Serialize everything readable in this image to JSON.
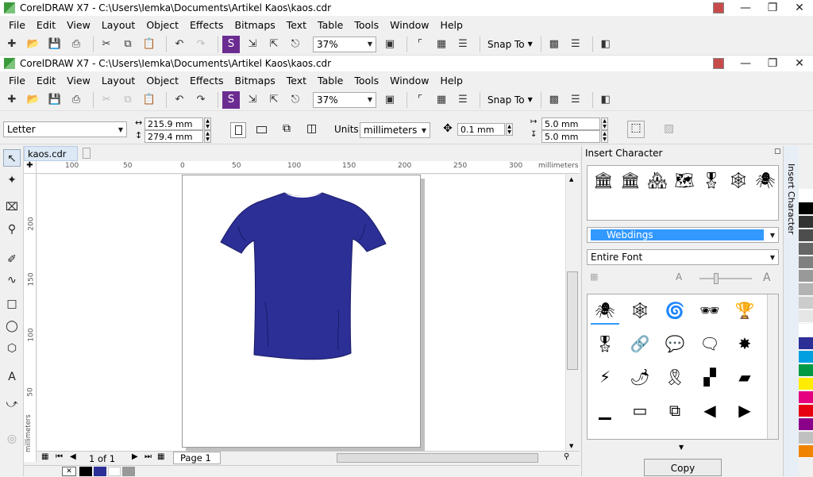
{
  "window1": {
    "title": "CorelDRAW X7 - C:\\Users\\Iemka\\Documents\\Artikel Kaos\\kaos.cdr"
  },
  "window2": {
    "title": "CorelDRAW X7 - C:\\Users\\Iemka\\Documents\\Artikel Kaos\\kaos.cdr"
  },
  "menu": [
    "File",
    "Edit",
    "View",
    "Layout",
    "Object",
    "Effects",
    "Bitmaps",
    "Text",
    "Table",
    "Tools",
    "Window",
    "Help"
  ],
  "toolbar": {
    "zoom": "37%",
    "snap_label": "Snap To"
  },
  "property_bar": {
    "page_size": "Letter",
    "width": "215.9 mm",
    "height": "279.4 mm",
    "units_label": "Units:",
    "units_value": "millimeters",
    "nudge": "0.1 mm",
    "dup_x": "5.0 mm",
    "dup_y": "5.0 mm"
  },
  "document": {
    "tab_name": "kaos.cdr",
    "ruler_unit": "millimeters",
    "tshirt_color": "#2c2f96"
  },
  "h_ruler_labels": [
    "100",
    "50",
    "0",
    "50",
    "100",
    "150",
    "200",
    "250",
    "300"
  ],
  "v_ruler_labels": [
    "200",
    "150",
    "100",
    "50"
  ],
  "v_ruler_unit": "millimeters",
  "page_nav": {
    "counter": "1 of 1",
    "page_tab": "Page 1"
  },
  "docker": {
    "title": "Insert Character",
    "side_tab": "Insert Character",
    "font": "Webdings",
    "subset": "Entire Font",
    "copy_button": "Copy",
    "recent_glyphs": [
      "🏛",
      "🏛",
      "🏘",
      "🗺",
      "🎖",
      "🕸",
      "🕷"
    ],
    "glyph_rows": [
      [
        "🕷",
        "🕸",
        "🌀",
        "🕶",
        "🏆"
      ],
      [
        "🎖",
        "🔗",
        "💬",
        "🗨",
        "✸"
      ],
      [
        "⚡",
        "🌶",
        "🎗",
        "▞",
        "▰"
      ],
      [
        "▁",
        "▭",
        "⧉",
        "◀",
        "▶"
      ]
    ]
  },
  "palette": [
    "#ffffff",
    "#000000",
    "#333333",
    "#4d4d4d",
    "#666666",
    "#808080",
    "#999999",
    "#b3b3b3",
    "#cccccc",
    "#e6e6e6",
    "#ffffff",
    "#2c2f96",
    "#00a0e0",
    "#009944",
    "#ffec00",
    "#e4007f",
    "#e60012",
    "#8b008b",
    "#c0c0c0",
    "#f08300"
  ],
  "status_swatches": [
    "#000000",
    "#2c2f96",
    "#ffffff",
    "#999999"
  ]
}
